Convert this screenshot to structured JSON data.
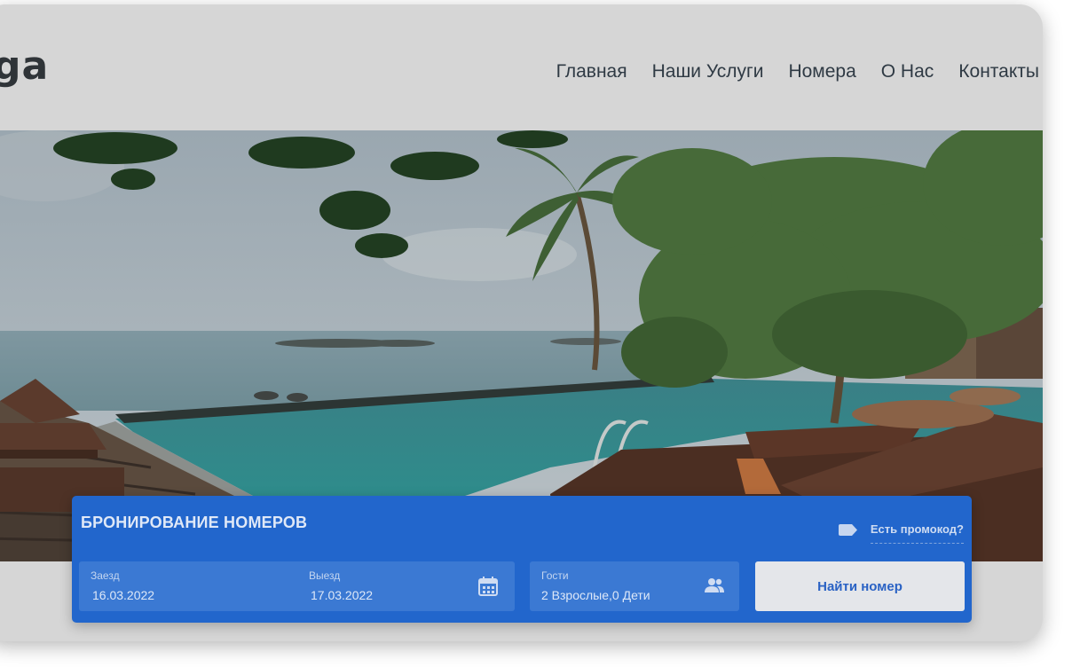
{
  "header": {
    "logo": "ga",
    "nav": [
      "Главная",
      "Наши Услуги",
      "Номера",
      "О Нас",
      "Контакты"
    ]
  },
  "booking": {
    "title": "БРОНИРОВАНИЕ НОМЕРОВ",
    "promo_link": "Есть промокод?",
    "checkin_label": "Заезд",
    "checkin_value": "16.03.2022",
    "checkout_label": "Выезд",
    "checkout_value": "17.03.2022",
    "guests_label": "Гости",
    "guests_value": "2 Взрослые,0 Дети",
    "search_button": "Найти номер"
  },
  "icons": {
    "calendar": "calendar-icon",
    "guests": "users-icon",
    "promo": "tag-icon"
  },
  "colors": {
    "booking_panel": "#2266cc",
    "field": "#3b79d3",
    "button_text": "#2a62c4"
  }
}
